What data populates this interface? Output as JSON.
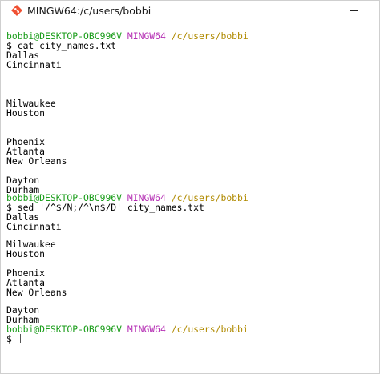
{
  "window": {
    "title": "MINGW64:/c/users/bobbi",
    "icon": "git-bash-icon"
  },
  "prompt": {
    "user": "bobbi@DESKTOP-OBC996V",
    "system": "MINGW64",
    "path": "/c/users/bobbi",
    "symbol": "$"
  },
  "terminal": {
    "cmd1": "cat city_names.txt",
    "output1": [
      "Dallas",
      "Cincinnati",
      "",
      "",
      "",
      "Milwaukee",
      "Houston",
      "",
      "",
      "Phoenix",
      "Atlanta",
      "New Orleans",
      "",
      "Dayton",
      "Durham"
    ],
    "cmd2": "sed '/^$/N;/^\\n$/D' city_names.txt",
    "output2": [
      "Dallas",
      "Cincinnati",
      "",
      "Milwaukee",
      "Houston",
      "",
      "Phoenix",
      "Atlanta",
      "New Orleans",
      "",
      "Dayton",
      "Durham"
    ],
    "input": ""
  },
  "colors": {
    "user": "#1b9d1b",
    "system": "#b52fb4",
    "path": "#b08a00"
  }
}
